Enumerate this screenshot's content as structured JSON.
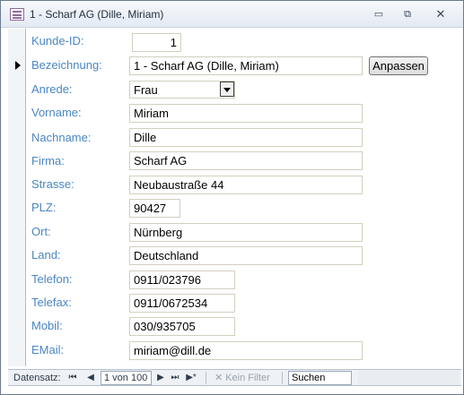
{
  "window": {
    "title": "1 - Scharf AG (Dille, Miriam)",
    "minimize_glyph": "▭",
    "maximize_glyph": "⧉",
    "close_glyph": "✕"
  },
  "fields": {
    "kunde_id": {
      "label": "Kunde-ID:",
      "value": "1"
    },
    "bezeichnung": {
      "label": "Bezeichnung:",
      "value": "1 - Scharf AG (Dille, Miriam)"
    },
    "anrede": {
      "label": "Anrede:",
      "value": "Frau"
    },
    "vorname": {
      "label": "Vorname:",
      "value": "Miriam"
    },
    "nachname": {
      "label": "Nachname:",
      "value": "Dille"
    },
    "firma": {
      "label": "Firma:",
      "value": "Scharf AG"
    },
    "strasse": {
      "label": "Strasse:",
      "value": "Neubaustraße 44"
    },
    "plz": {
      "label": "PLZ:",
      "value": "90427"
    },
    "ort": {
      "label": "Ort:",
      "value": "Nürnberg"
    },
    "land": {
      "label": "Land:",
      "value": "Deutschland"
    },
    "telefon": {
      "label": "Telefon:",
      "value": "0911/023796"
    },
    "telefax": {
      "label": "Telefax:",
      "value": "0911/0672534"
    },
    "mobil": {
      "label": "Mobil:",
      "value": "030/935705"
    },
    "email": {
      "label": "EMail:",
      "value": "miriam@dill.de"
    }
  },
  "buttons": {
    "anpassen": "Anpassen"
  },
  "navigation": {
    "label": "Datensatz:",
    "first_glyph": "⏮",
    "prev_glyph": "◀",
    "position": "1 von 100",
    "next_glyph": "▶",
    "last_glyph": "⏭",
    "new_glyph": "▶*",
    "filter_label": "Kein Filter",
    "search_label": "Suchen"
  },
  "colors": {
    "label": "#4a86c3",
    "field_border": "#d2cfbf",
    "accent": "#8f6a9e"
  }
}
